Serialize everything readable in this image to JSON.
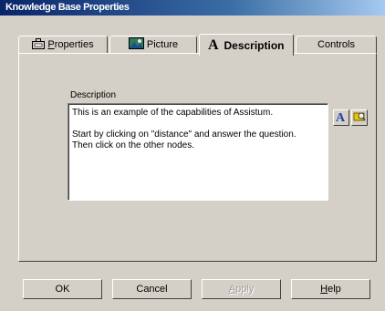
{
  "window": {
    "title": "Knowledge Base Properties"
  },
  "tabs": [
    {
      "label_pre": "",
      "label_accel": "P",
      "label_post": "roperties",
      "icon": "properties-icon"
    },
    {
      "label_pre": "Picture",
      "label_accel": "",
      "label_post": "",
      "icon": "picture-icon"
    },
    {
      "label_pre": "Description",
      "label_accel": "",
      "label_post": "",
      "icon": "font-a-icon"
    },
    {
      "label_pre": "Controls",
      "label_accel": "",
      "label_post": "",
      "icon": ""
    }
  ],
  "description": {
    "label": "Description",
    "text": "This is an example of the capabilities of Assistum.\n\nStart by clicking on \"distance\" and answer the question.\nThen click on the other nodes.",
    "font_button_icon": "font-a-icon",
    "browse_button_icon": "folder-browse-icon"
  },
  "buttons": {
    "ok": "OK",
    "cancel": "Cancel",
    "apply_accel": "A",
    "apply_rest": "pply",
    "help_accel": "H",
    "help_rest": "elp"
  },
  "colors": {
    "face": "#d4d0c8",
    "title_start": "#0a246a",
    "title_end": "#a6caf0",
    "font_icon": "#1c3fa8"
  }
}
